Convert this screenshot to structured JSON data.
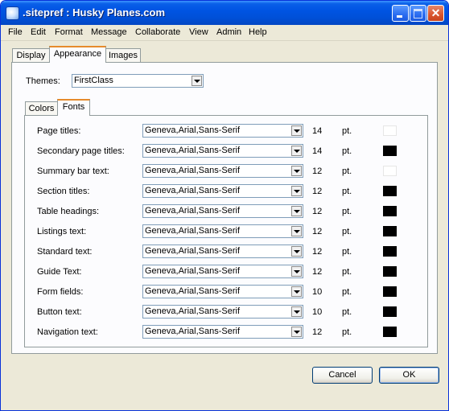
{
  "window": {
    "title": ".sitepref : Husky Planes.com"
  },
  "menubar": [
    "File",
    "Edit",
    "Format",
    "Message",
    "Collaborate",
    "View",
    "Admin",
    "Help"
  ],
  "tabs": [
    {
      "label": "Display",
      "active": false
    },
    {
      "label": "Appearance",
      "active": true
    },
    {
      "label": "Images",
      "active": false
    }
  ],
  "themes": {
    "label": "Themes:",
    "value": "FirstClass"
  },
  "subtabs": [
    {
      "label": "Colors",
      "active": false
    },
    {
      "label": "Fonts",
      "active": true
    }
  ],
  "font_rows": [
    {
      "label": "Page titles:",
      "font": "Geneva,Arial,Sans-Serif",
      "size": "14",
      "unit": "pt.",
      "color": "#ffffff"
    },
    {
      "label": "Secondary page titles:",
      "font": "Geneva,Arial,Sans-Serif",
      "size": "14",
      "unit": "pt.",
      "color": "#000000"
    },
    {
      "label": "Summary bar text:",
      "font": "Geneva,Arial,Sans-Serif",
      "size": "12",
      "unit": "pt.",
      "color": "#ffffff"
    },
    {
      "label": "Section titles:",
      "font": "Geneva,Arial,Sans-Serif",
      "size": "12",
      "unit": "pt.",
      "color": "#000000"
    },
    {
      "label": "Table headings:",
      "font": "Geneva,Arial,Sans-Serif",
      "size": "12",
      "unit": "pt.",
      "color": "#000000"
    },
    {
      "label": "Listings text:",
      "font": "Geneva,Arial,Sans-Serif",
      "size": "12",
      "unit": "pt.",
      "color": "#000000"
    },
    {
      "label": "Standard text:",
      "font": "Geneva,Arial,Sans-Serif",
      "size": "12",
      "unit": "pt.",
      "color": "#000000"
    },
    {
      "label": "Guide Text:",
      "font": "Geneva,Arial,Sans-Serif",
      "size": "12",
      "unit": "pt.",
      "color": "#000000"
    },
    {
      "label": "Form fields:",
      "font": "Geneva,Arial,Sans-Serif",
      "size": "10",
      "unit": "pt.",
      "color": "#000000"
    },
    {
      "label": "Button text:",
      "font": "Geneva,Arial,Sans-Serif",
      "size": "10",
      "unit": "pt.",
      "color": "#000000"
    },
    {
      "label": "Navigation text:",
      "font": "Geneva,Arial,Sans-Serif",
      "size": "12",
      "unit": "pt.",
      "color": "#000000"
    }
  ],
  "buttons": {
    "cancel": "Cancel",
    "ok": "OK"
  },
  "colors": {
    "titlebar": "#0054e3",
    "dialog_bg": "#ece9d8",
    "active_tab_accent": "#e68b2c"
  }
}
